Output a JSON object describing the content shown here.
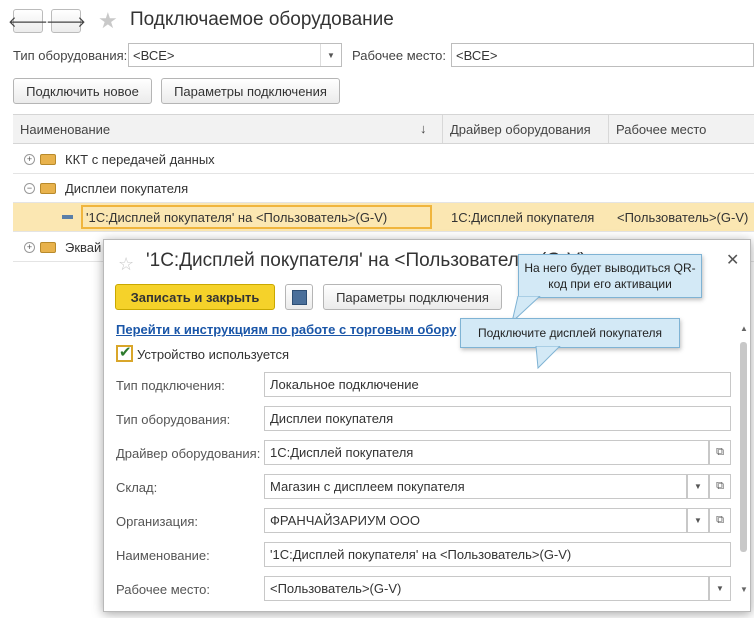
{
  "header": {
    "back_icon": "arrow-left-icon",
    "forward_icon": "arrow-right-icon",
    "title": "Подключаемое оборудование"
  },
  "filters": {
    "equipment_type_label": "Тип оборудования:",
    "equipment_type_value": "<ВСЕ>",
    "workplace_label": "Рабочее место:",
    "workplace_value": "<ВСЕ>"
  },
  "toolbar": {
    "connect_new": "Подключить новое",
    "connection_params": "Параметры подключения"
  },
  "table": {
    "columns": [
      "Наименование",
      "Драйвер оборудования",
      "Рабочее место"
    ],
    "sort_indicator": "↓",
    "rows": [
      {
        "name": "ККТ с передачей данных",
        "driver": "",
        "workplace": "",
        "type": "group"
      },
      {
        "name": "Дисплеи покупателя",
        "driver": "",
        "workplace": "",
        "type": "group"
      },
      {
        "name": "'1С:Дисплей покупателя' на <Пользователь>(G-V)",
        "driver": "1С:Дисплей покупателя",
        "workplace": "<Пользователь>(G-V)",
        "type": "item"
      },
      {
        "name": "Эквай",
        "driver": "",
        "workplace": "",
        "type": "group"
      }
    ]
  },
  "dialog": {
    "title": "'1С:Дисплей покупателя' на <Пользователь>(G-V)",
    "save_close": "Записать и закрыть",
    "params_button": "Параметры подключения",
    "link": "Перейти к инструкциям по работе с торговым обору",
    "device_used_label": "Устройство используется",
    "device_used": true,
    "fields": [
      {
        "label": "Тип подключения:",
        "value": "Локальное подключение"
      },
      {
        "label": "Тип оборудования:",
        "value": "Дисплеи покупателя"
      },
      {
        "label": "Драйвер оборудования:",
        "value": "1С:Дисплей покупателя"
      },
      {
        "label": "Склад:",
        "value": "Магазин с дисплеем покупателя"
      },
      {
        "label": "Организация:",
        "value": "ФРАНЧАЙЗАРИУМ ООО"
      },
      {
        "label": "Наименование:",
        "value": "'1С:Дисплей покупателя' на <Пользователь>(G-V)"
      },
      {
        "label": "Рабочее место:",
        "value": "<Пользователь>(G-V)"
      }
    ]
  },
  "callouts": {
    "qr": "На него будет выводиться QR-код при его активации",
    "connect": "Подключите дисплей покупателя"
  },
  "colors": {
    "accent_yellow": "#f5d22a",
    "link_blue": "#1a56a8",
    "selected_row": "#fbe7b2",
    "callout_bg": "#d3e9f6"
  }
}
